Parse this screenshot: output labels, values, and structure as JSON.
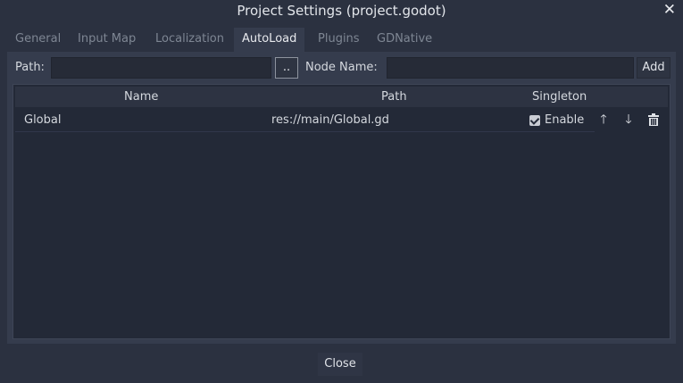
{
  "window": {
    "title": "Project Settings (project.godot)",
    "close_icon": "close-icon"
  },
  "tabs": [
    {
      "label": "General"
    },
    {
      "label": "Input Map"
    },
    {
      "label": "Localization"
    },
    {
      "label": "AutoLoad",
      "active": true
    },
    {
      "label": "Plugins"
    },
    {
      "label": "GDNative"
    }
  ],
  "autoload": {
    "path_label": "Path:",
    "path_value": "",
    "browse_label": "..",
    "node_name_label": "Node Name:",
    "node_name_value": "",
    "add_label": "Add",
    "columns": [
      "Name",
      "Path",
      "Singleton"
    ],
    "rows": [
      {
        "name": "Global",
        "path": "res://main/Global.gd",
        "singleton_checked": true,
        "singleton_label": "Enable",
        "icons": [
          "arrow-up-icon",
          "arrow-down-icon",
          "trash-icon"
        ]
      }
    ]
  },
  "footer": {
    "close_label": "Close"
  },
  "colors": {
    "background": "#2b3140",
    "panel": "#353c4d",
    "tree": "#232937",
    "text": "#d4d8de",
    "inactive_tab": "#7e8693"
  }
}
